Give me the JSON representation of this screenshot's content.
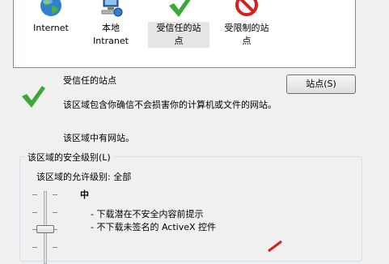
{
  "zones": [
    {
      "label": "Internet",
      "icon": "globe-icon",
      "selected": false
    },
    {
      "label": "本地\nIntranet",
      "icon": "intranet-icon",
      "selected": false
    },
    {
      "label": "受信任的站\n点",
      "icon": "trusted-check-icon",
      "selected": true
    },
    {
      "label": "受限制的站\n点",
      "icon": "restricted-icon",
      "selected": false
    }
  ],
  "detail": {
    "title": "受信任的站点",
    "description": "该区域包含你确信不会损害你的计算机或文件的网站。",
    "sites_note": "该区域中有网站。",
    "sites_button": "站点(S)"
  },
  "security": {
    "group_title": "该区域的安全级别(L)",
    "allowed_levels": "该区域的允许级别: 全部",
    "level_name": "中",
    "bullets": [
      "- 下载潜在不安全内容前提示",
      "- 不下载未签名的 ActiveX 控件"
    ]
  },
  "colors": {
    "accent_check": "#3aa935",
    "restricted_red": "#d61f1f",
    "selection_bg": "#e5e5e5"
  }
}
